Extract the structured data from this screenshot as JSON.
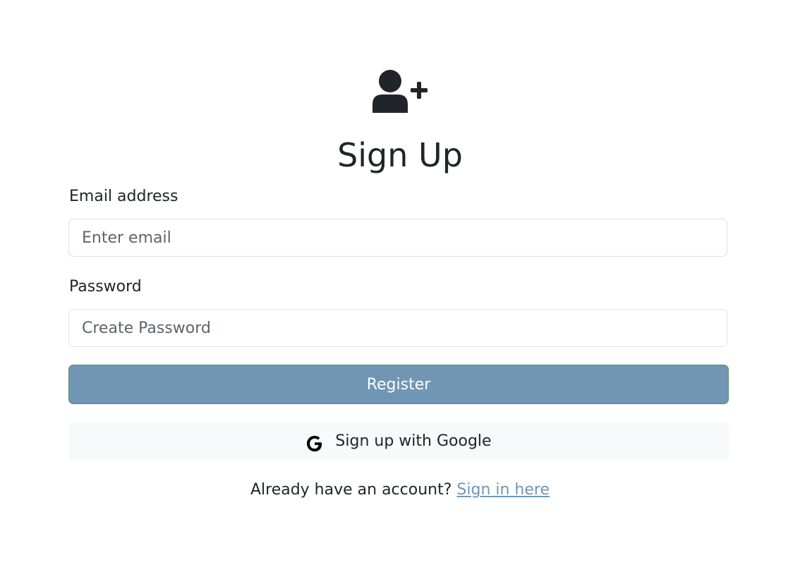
{
  "header": {
    "icon": "user-plus-icon",
    "title": "Sign Up"
  },
  "form": {
    "email_label": "Email address",
    "email_placeholder": "Enter email",
    "email_value": "",
    "password_label": "Password",
    "password_placeholder": "Create Password",
    "password_value": "",
    "register_label": "Register",
    "google_label": "Sign up with Google",
    "google_icon": "google-icon"
  },
  "footer": {
    "prompt": "Already have an account?",
    "link_label": "Sign in here"
  },
  "colors": {
    "primary": "#7096b4",
    "text": "#212529",
    "input_border": "#dee2e6",
    "google_bg": "#f8f9fa"
  }
}
